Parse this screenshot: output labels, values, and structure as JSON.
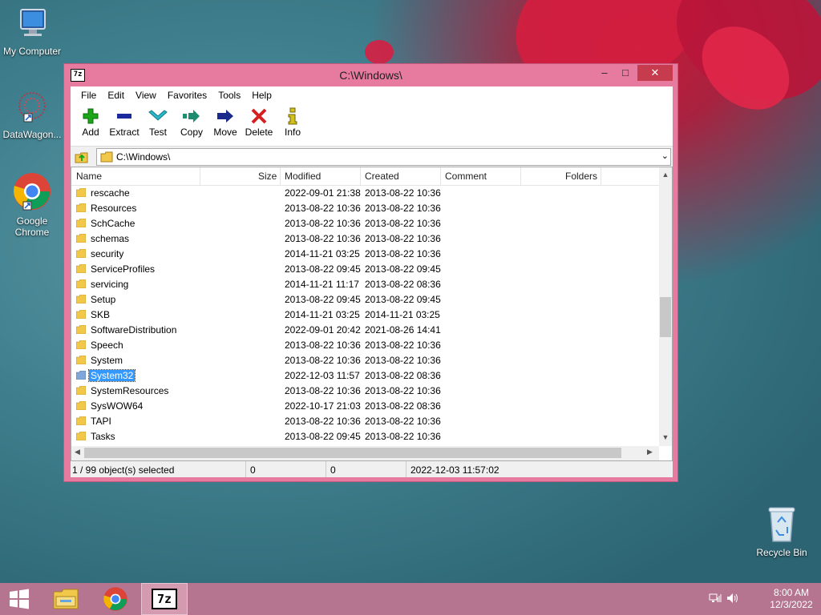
{
  "desktop": {
    "icons": [
      {
        "label": "My Computer"
      },
      {
        "label": "DataWagon..."
      },
      {
        "label": "Google Chrome"
      },
      {
        "label": "Recycle Bin"
      }
    ]
  },
  "window": {
    "title": "C:\\Windows\\",
    "app_icon_text": "7z",
    "controls": {
      "minimize": "–",
      "maximize": "□",
      "close": "✕"
    }
  },
  "menu": [
    "File",
    "Edit",
    "View",
    "Favorites",
    "Tools",
    "Help"
  ],
  "toolbar": [
    {
      "label": "Add",
      "icon": "plus-icon",
      "color": "#1aa51a"
    },
    {
      "label": "Extract",
      "icon": "minus-icon",
      "color": "#1a2a9c"
    },
    {
      "label": "Test",
      "icon": "check-chevron-icon",
      "color": "#2ab8c8"
    },
    {
      "label": "Copy",
      "icon": "double-arrow-right-icon",
      "color": "#1e8c6e"
    },
    {
      "label": "Move",
      "icon": "arrow-right-icon",
      "color": "#1a2a8c"
    },
    {
      "label": "Delete",
      "icon": "x-icon",
      "color": "#d42020"
    },
    {
      "label": "Info",
      "icon": "info-icon",
      "color": "#d4c21a"
    }
  ],
  "address": {
    "path": "C:\\Windows\\"
  },
  "columns": [
    "Name",
    "Size",
    "Modified",
    "Created",
    "Comment",
    "Folders"
  ],
  "files": [
    {
      "name": "rescache",
      "modified": "2022-09-01 21:38",
      "created": "2013-08-22 10:36"
    },
    {
      "name": "Resources",
      "modified": "2013-08-22 10:36",
      "created": "2013-08-22 10:36"
    },
    {
      "name": "SchCache",
      "modified": "2013-08-22 10:36",
      "created": "2013-08-22 10:36"
    },
    {
      "name": "schemas",
      "modified": "2013-08-22 10:36",
      "created": "2013-08-22 10:36"
    },
    {
      "name": "security",
      "modified": "2014-11-21 03:25",
      "created": "2013-08-22 10:36"
    },
    {
      "name": "ServiceProfiles",
      "modified": "2013-08-22 09:45",
      "created": "2013-08-22 09:45"
    },
    {
      "name": "servicing",
      "modified": "2014-11-21 11:17",
      "created": "2013-08-22 08:36"
    },
    {
      "name": "Setup",
      "modified": "2013-08-22 09:45",
      "created": "2013-08-22 09:45"
    },
    {
      "name": "SKB",
      "modified": "2014-11-21 03:25",
      "created": "2014-11-21 03:25"
    },
    {
      "name": "SoftwareDistribution",
      "modified": "2022-09-01 20:42",
      "created": "2021-08-26 14:41"
    },
    {
      "name": "Speech",
      "modified": "2013-08-22 10:36",
      "created": "2013-08-22 10:36"
    },
    {
      "name": "System",
      "modified": "2013-08-22 10:36",
      "created": "2013-08-22 10:36"
    },
    {
      "name": "System32",
      "modified": "2022-12-03 11:57",
      "created": "2013-08-22 08:36",
      "selected": true
    },
    {
      "name": "SystemResources",
      "modified": "2013-08-22 10:36",
      "created": "2013-08-22 10:36"
    },
    {
      "name": "SysWOW64",
      "modified": "2022-10-17 21:03",
      "created": "2013-08-22 08:36"
    },
    {
      "name": "TAPI",
      "modified": "2013-08-22 10:36",
      "created": "2013-08-22 10:36"
    },
    {
      "name": "Tasks",
      "modified": "2013-08-22 09:45",
      "created": "2013-08-22 10:36"
    }
  ],
  "status": {
    "selection": "1 / 99 object(s) selected",
    "size1": "0",
    "size2": "0",
    "timestamp": "2022-12-03 11:57:02"
  },
  "taskbar": {
    "time": "8:00 AM",
    "date": "12/3/2022",
    "active_app_text": "7z"
  }
}
